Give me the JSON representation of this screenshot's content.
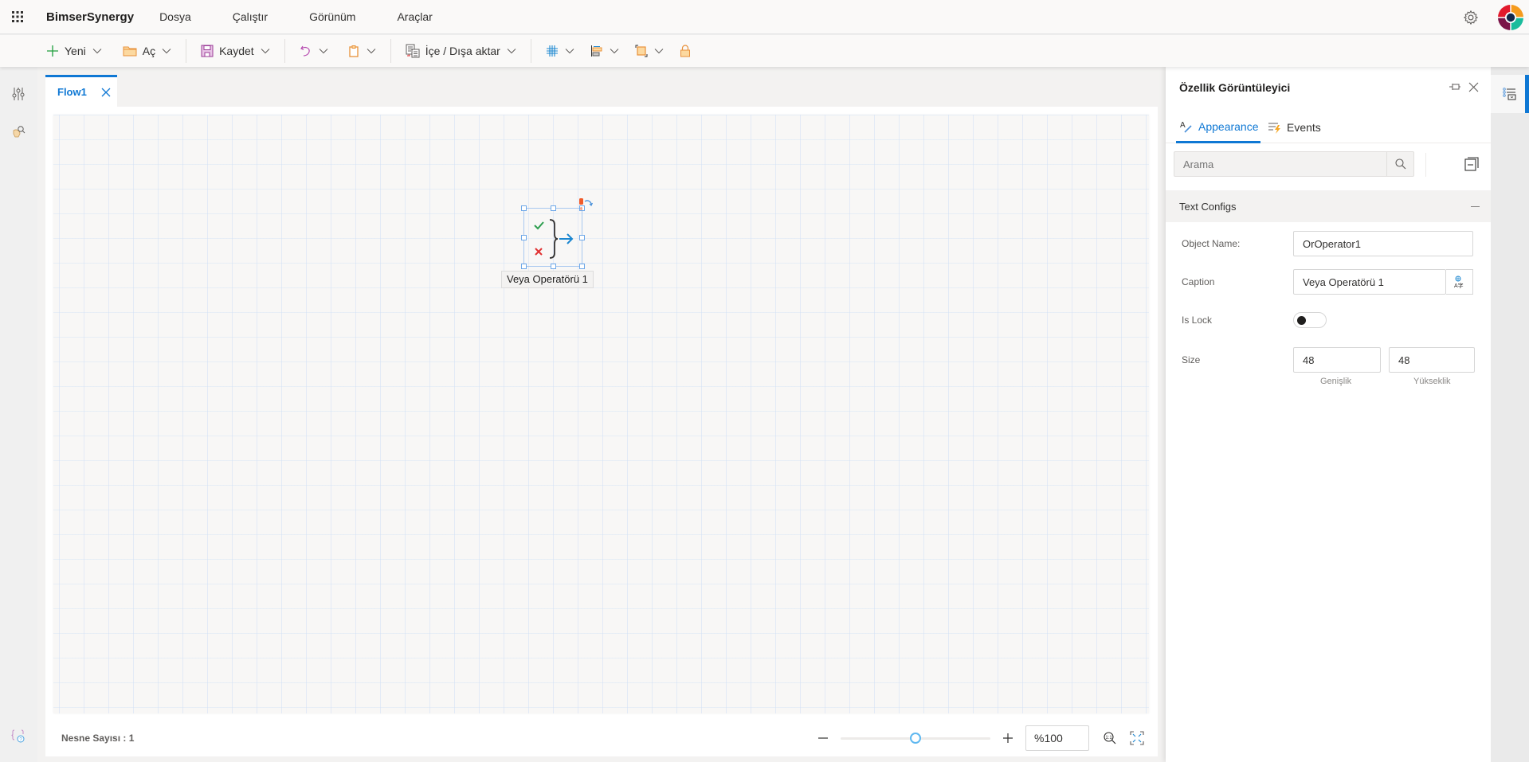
{
  "header": {
    "app_name": "BimserSynergy",
    "menu": [
      "Dosya",
      "Çalıştır",
      "Görünüm",
      "Araçlar"
    ]
  },
  "toolbar": {
    "new_label": "Yeni",
    "open_label": "Aç",
    "save_label": "Kaydet",
    "import_export_label": "İçe / Dışa aktar"
  },
  "tabs": [
    {
      "label": "Flow1",
      "active": true
    }
  ],
  "canvas": {
    "nodes": [
      {
        "caption": "Veya Operatörü 1",
        "type": "or-operator"
      }
    ]
  },
  "statusbar": {
    "object_count_label": "Nesne Sayısı : 1",
    "zoom_value": "%100",
    "zoom_slider_fraction": 0.5
  },
  "panel": {
    "title": "Özellik Görüntüleyici",
    "tabs": [
      {
        "label": "Appearance",
        "active": true
      },
      {
        "label": "Events",
        "active": false
      }
    ],
    "search_placeholder": "Arama",
    "section_title": "Text Configs",
    "fields": {
      "object_name_label": "Object Name:",
      "object_name_value": "OrOperator1",
      "caption_label": "Caption",
      "caption_value": "Veya Operatörü 1",
      "is_lock_label": "Is Lock",
      "is_lock_value": false,
      "size_label": "Size",
      "width_value": "48",
      "height_value": "48",
      "width_sublabel": "Genişlik",
      "height_sublabel": "Yükseklik"
    }
  },
  "colors": {
    "accent": "#0f78d4",
    "success": "#2e9e4f",
    "danger": "#e03030"
  }
}
